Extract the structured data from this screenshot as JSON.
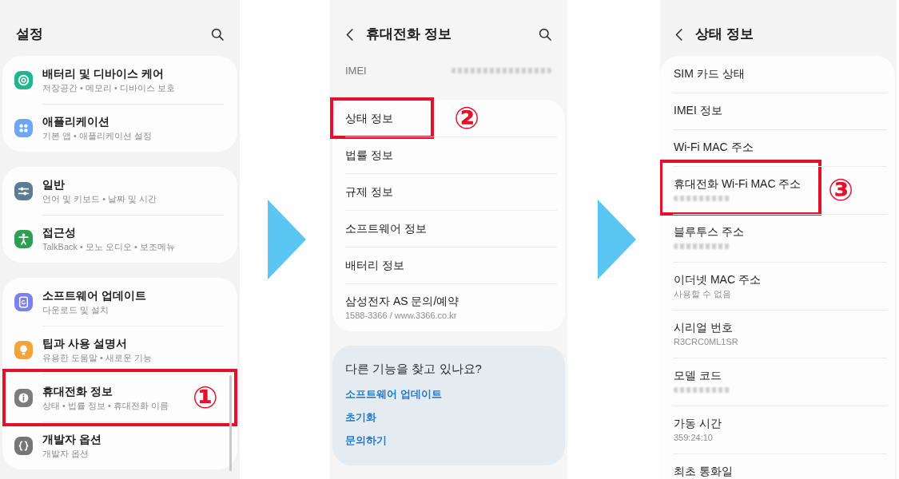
{
  "settings_screen": {
    "title": "설정",
    "groups": [
      {
        "items": [
          {
            "title": "배터리 및 디바이스 케어",
            "subtitle": "저장공간 • 메모리 • 디바이스 보호",
            "color": "#1fb58e",
            "highlighted": false
          },
          {
            "title": "애플리케이션",
            "subtitle": "기본 앱 • 애플리케이션 설정",
            "color": "#6ba6f7",
            "highlighted": false
          }
        ]
      },
      {
        "items": [
          {
            "title": "일반",
            "subtitle": "언어 및 키보드 • 날짜 및 시간",
            "color": "#5a7c95",
            "highlighted": false
          },
          {
            "title": "접근성",
            "subtitle": "TalkBack • 모노 오디오 • 보조메뉴",
            "color": "#2f9e52",
            "highlighted": false
          }
        ]
      },
      {
        "items": [
          {
            "title": "소프트웨어 업데이트",
            "subtitle": "다운로드 및 설치",
            "color": "#7b80f0",
            "highlighted": false
          },
          {
            "title": "팁과 사용 설명서",
            "subtitle": "유용한 도움말 • 새로운 기능",
            "color": "#f4a23b",
            "highlighted": false
          },
          {
            "title": "휴대전화 정보",
            "subtitle": "상태 • 법률 정보 • 휴대전화 이름",
            "color": "#7c7c7c",
            "highlighted": true,
            "step": "①"
          },
          {
            "title": "개발자 옵션",
            "subtitle": "개발자 옵션",
            "color": "#767676",
            "highlighted": false
          }
        ]
      }
    ]
  },
  "phone_info_screen": {
    "title": "휴대전화 정보",
    "imei": {
      "label": "IMEI",
      "value_redacted": true
    },
    "items": [
      {
        "title": "상태 정보",
        "highlighted": true,
        "step": "②"
      },
      {
        "title": "법률 정보",
        "highlighted": false
      },
      {
        "title": "규제 정보",
        "highlighted": false
      },
      {
        "title": "소프트웨어 정보",
        "highlighted": false
      },
      {
        "title": "배터리 정보",
        "highlighted": false
      },
      {
        "title": "삼성전자 AS 문의/예약",
        "subtitle": "1588-3366 / www.3366.co.kr",
        "highlighted": false
      }
    ],
    "suggestions": {
      "heading": "다른 기능을 찾고 있나요?",
      "links": [
        "소프트웨어 업데이트",
        "초기화",
        "문의하기"
      ]
    }
  },
  "status_info_screen": {
    "title": "상태 정보",
    "items": [
      {
        "title": "SIM 카드 상태",
        "value_redacted": false,
        "highlighted": false
      },
      {
        "title": "IMEI 정보",
        "value_redacted": false,
        "highlighted": false
      },
      {
        "title": "Wi-Fi MAC 주소",
        "value_redacted": false,
        "highlighted": false
      },
      {
        "title": "휴대전화 Wi-Fi MAC 주소",
        "value_redacted": true,
        "highlighted": true,
        "step": "③"
      },
      {
        "title": "블루투스 주소",
        "value_redacted": true,
        "highlighted": false
      },
      {
        "title": "이더넷 MAC 주소",
        "subtitle": "사용할 수 없음",
        "value_redacted": false,
        "highlighted": false
      },
      {
        "title": "시리얼 번호",
        "subtitle": "R3CRC0ML1SR",
        "value_redacted": false,
        "highlighted": false
      },
      {
        "title": "모델 코드",
        "value_redacted": true,
        "highlighted": false
      },
      {
        "title": "가동 시간",
        "subtitle": "359:24:10",
        "value_redacted": false,
        "highlighted": false
      },
      {
        "title": "최초 통화일",
        "value_redacted": false,
        "highlighted": false
      }
    ]
  }
}
